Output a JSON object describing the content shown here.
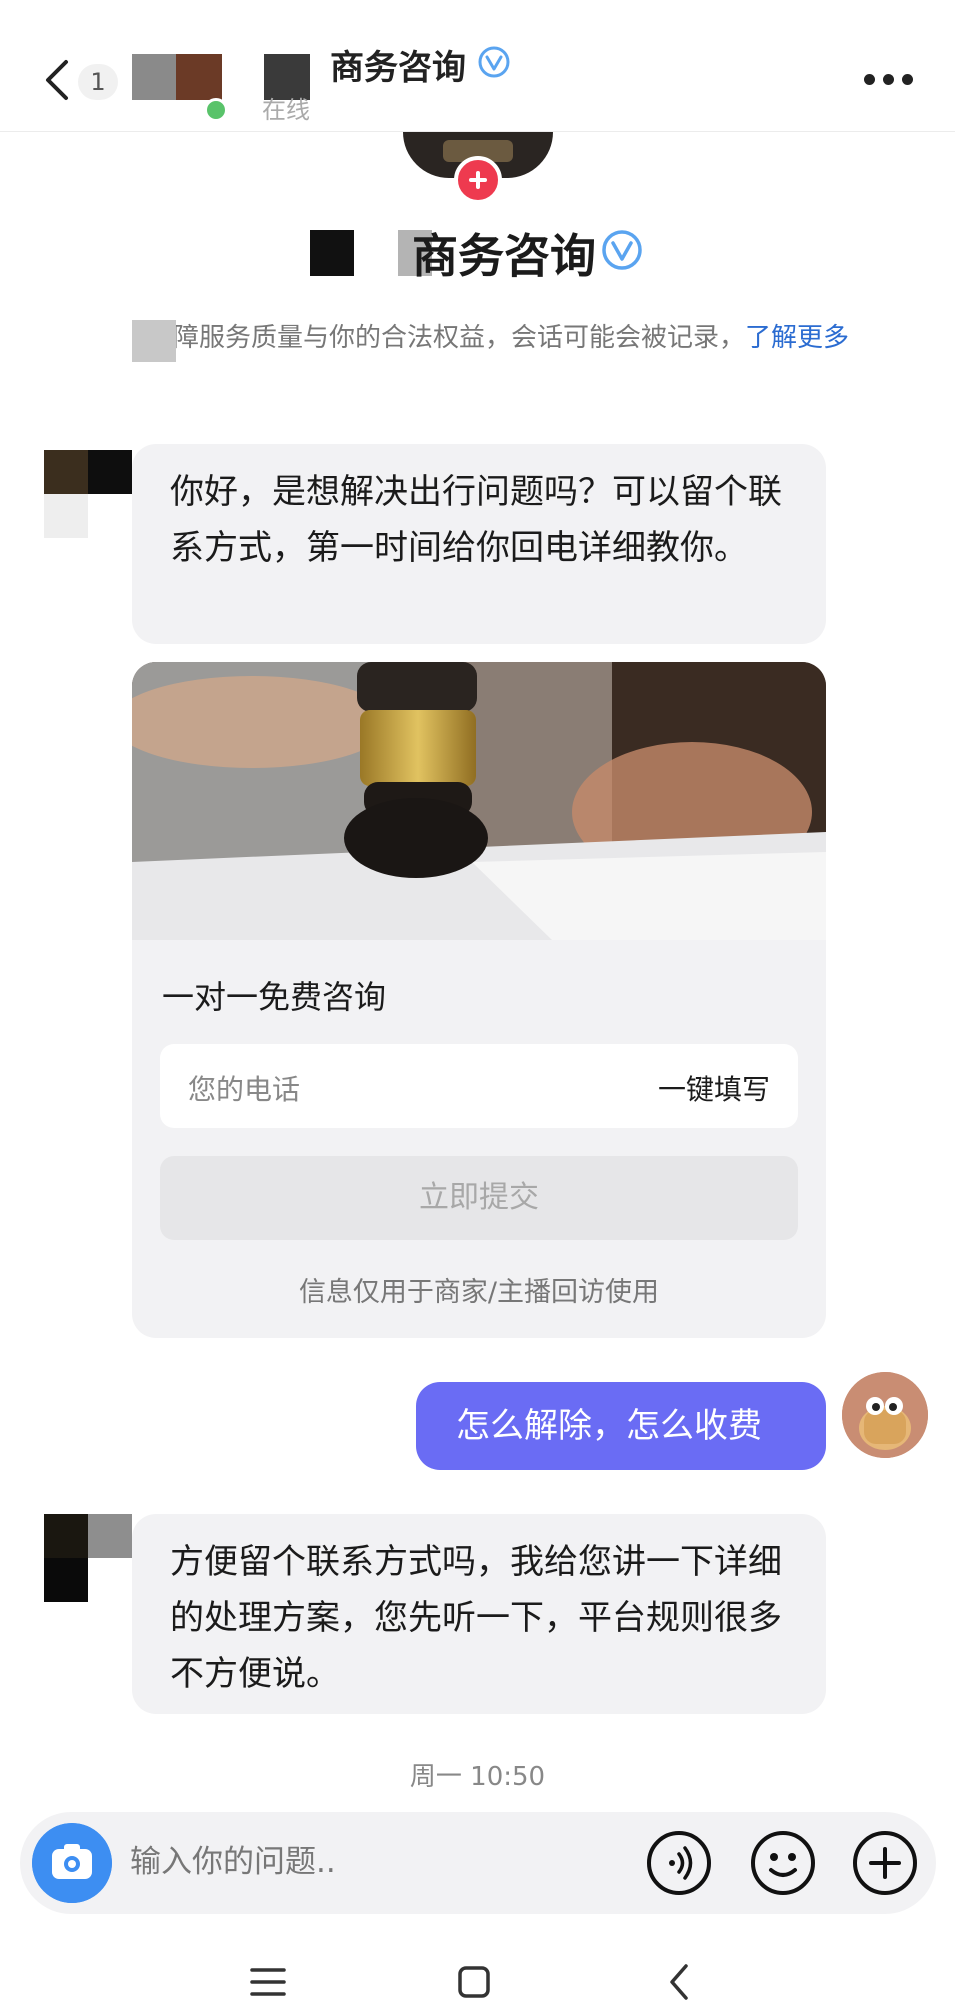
{
  "topbar": {
    "unread_count": "1",
    "title": "商务咨询",
    "status": "在线"
  },
  "profile": {
    "name": "商务咨询",
    "notice": "保障服务质量与你的合法权益，会话可能会被记录，",
    "notice_link": "了解更多"
  },
  "messages": {
    "msg1": "你好，是想解决出行问题吗？可以留个联系方式，第一时间给你回电详细教你。",
    "user_reply": "怎么解除，怎么收费",
    "msg2": "方便留个联系方式吗，我给您讲一下详细的处理方案，您先听一下，平台规则很多不方便说。"
  },
  "card": {
    "title": "一对一免费咨询",
    "phone_placeholder": "您的电话",
    "autofill_label": "一键填写",
    "submit_label": "立即提交",
    "footer": "信息仅用于商家/主播回访使用"
  },
  "timestamp": "周一 10:50",
  "composer": {
    "placeholder": "输入你的问题.."
  },
  "colors": {
    "accent_bubble": "#6a6cf4",
    "verified_blue": "#3d8ef2",
    "add_badge": "#ee3a4f",
    "link": "#2b6cd1"
  },
  "icons": [
    "back-icon",
    "more-icon",
    "verified-icon",
    "add-icon",
    "camera-icon",
    "voice-icon",
    "emoji-icon",
    "plus-icon",
    "menu-icon",
    "home-icon",
    "nav-back-icon"
  ]
}
